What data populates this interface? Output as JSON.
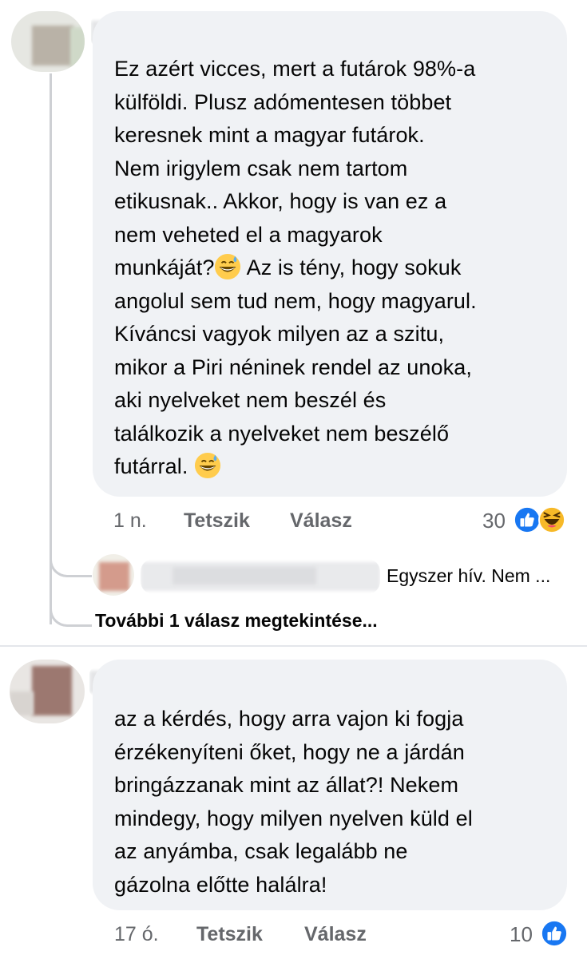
{
  "comments": [
    {
      "text_lines": [
        "Ez azért vicces, mert a futárok 98%-a",
        "külföldi. Plusz adómentesen többet",
        "keresnek mint a magyar futárok.",
        "Nem irigylem csak nem tartom",
        "etikusnak.. Akkor, hogy is van ez a",
        "nem veheted el a magyarok",
        "munkáját?",
        " Az is tény, hogy sokuk",
        "angolul sem tud nem, hogy magyarul.",
        "Kíváncsi vagyok milyen az a szitu,",
        "mikor a Piri néninek rendel az unoka,",
        "aki nyelveket nem beszél és",
        "találkozik a nyelveket nem beszélő",
        "futárral. "
      ],
      "time": "1 n.",
      "like_label": "Tetszik",
      "reply_label": "Válasz",
      "reaction_count": "30",
      "reactions": [
        "like-icon",
        "haha-icon"
      ]
    },
    {
      "text_lines": [
        "az a kérdés, hogy arra vajon ki fogja",
        "érzékenyíteni őket, hogy ne a járdán",
        "bringázzanak mint az állat?! Nekem",
        "mindegy, hogy milyen nyelven küld el",
        "az anyámba, csak legalább ne",
        "gázolna előtte halálra!"
      ],
      "time": "17 ó.",
      "like_label": "Tetszik",
      "reply_label": "Válasz",
      "reaction_count": "10",
      "reactions": [
        "like-icon"
      ]
    }
  ],
  "reply_preview": {
    "text": "Egyszer hív. Nem ..."
  },
  "more_replies_label": "További 1 válasz megtekintése...",
  "colors": {
    "bubble": "#f0f2f5",
    "meta": "#65676b",
    "like_blue": "#1877f2",
    "haha_yellow": "#f7b928"
  }
}
